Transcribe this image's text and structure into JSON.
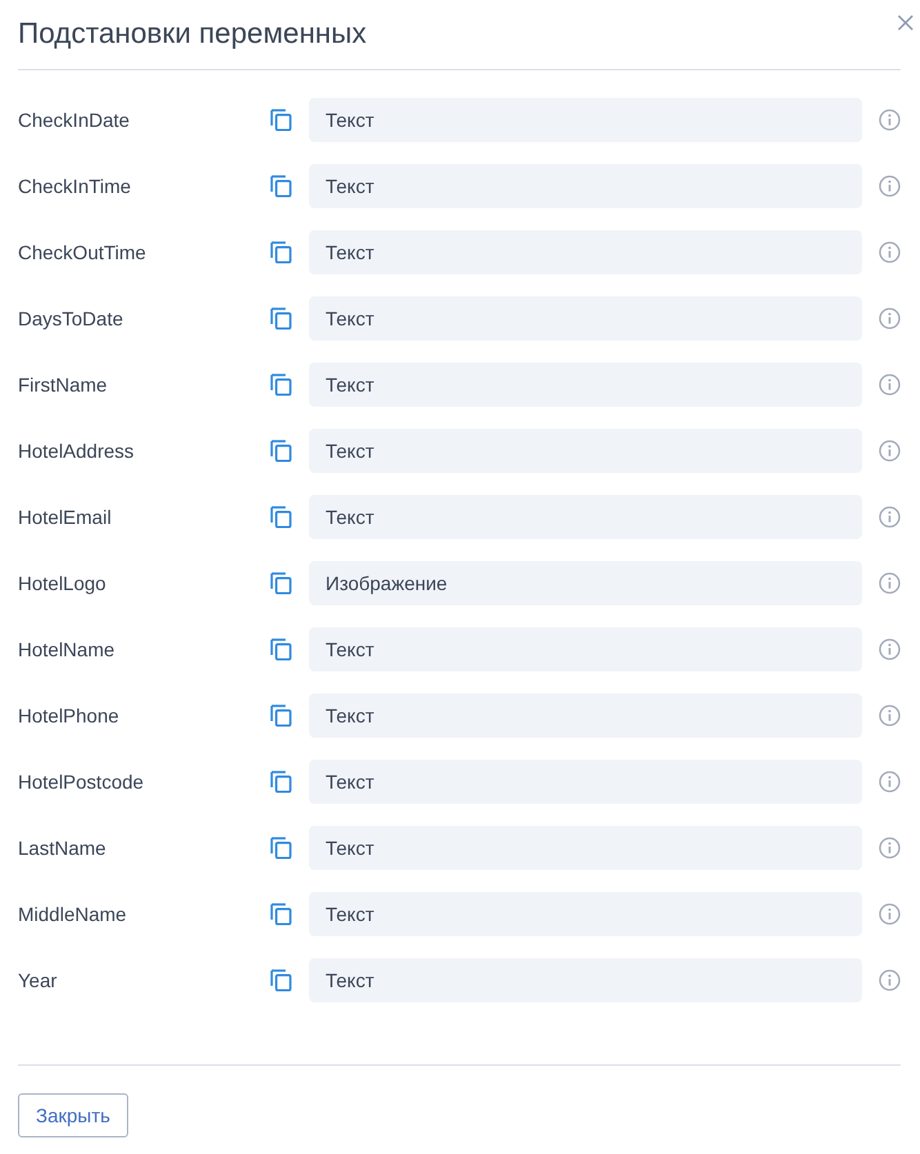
{
  "dialog": {
    "title": "Подстановки переменных",
    "variables": [
      {
        "name": "CheckInDate",
        "type": "Текст"
      },
      {
        "name": "CheckInTime",
        "type": "Текст"
      },
      {
        "name": "CheckOutTime",
        "type": "Текст"
      },
      {
        "name": "DaysToDate",
        "type": "Текст"
      },
      {
        "name": "FirstName",
        "type": "Текст"
      },
      {
        "name": "HotelAddress",
        "type": "Текст"
      },
      {
        "name": "HotelEmail",
        "type": "Текст"
      },
      {
        "name": "HotelLogo",
        "type": "Изображение"
      },
      {
        "name": "HotelName",
        "type": "Текст"
      },
      {
        "name": "HotelPhone",
        "type": "Текст"
      },
      {
        "name": "HotelPostcode",
        "type": "Текст"
      },
      {
        "name": "LastName",
        "type": "Текст"
      },
      {
        "name": "MiddleName",
        "type": "Текст"
      },
      {
        "name": "Year",
        "type": "Текст"
      }
    ],
    "buttons": [
      "Закрыть"
    ]
  }
}
